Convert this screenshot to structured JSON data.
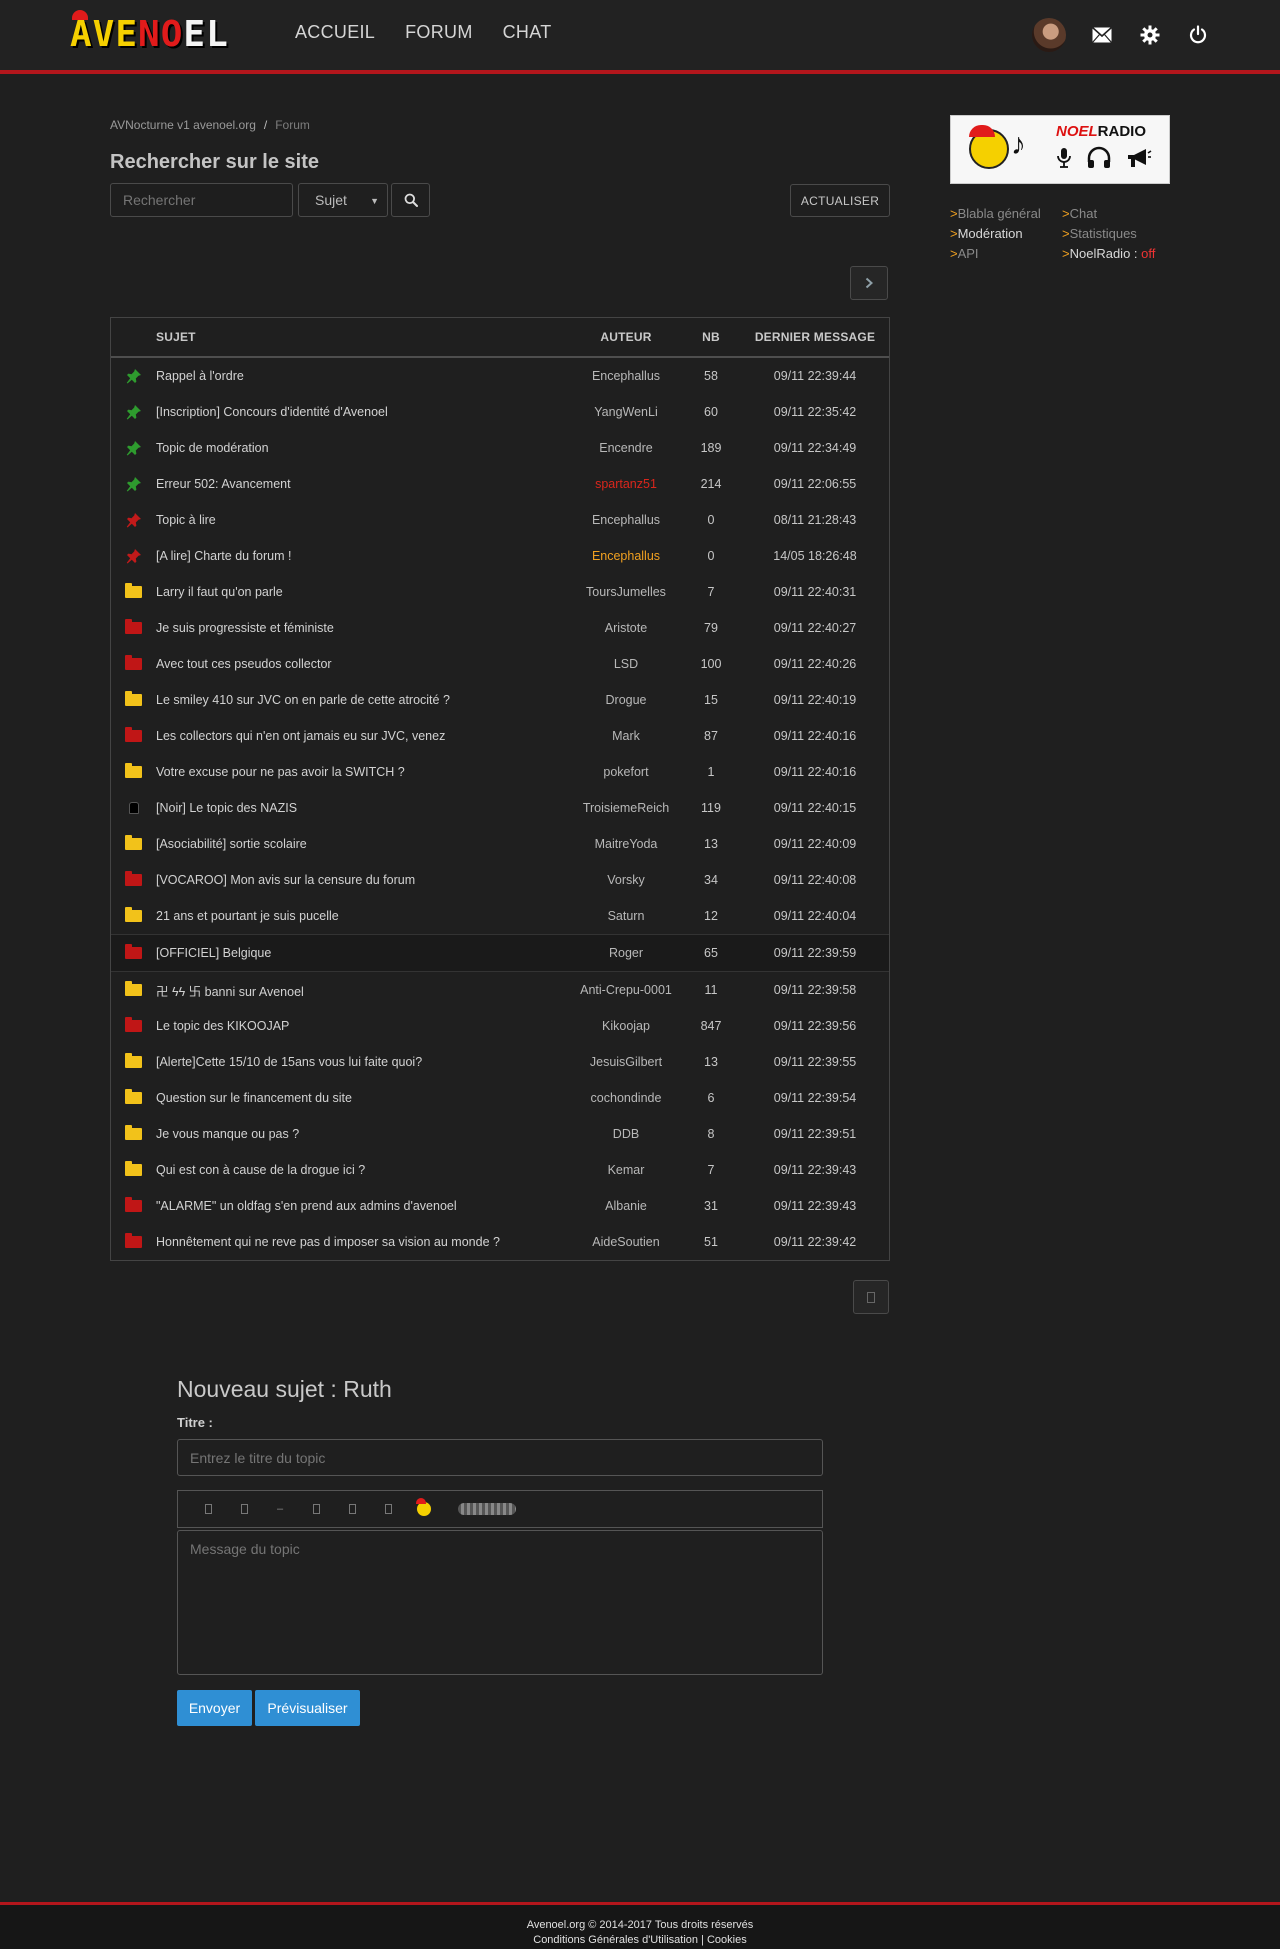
{
  "header": {
    "logo": {
      "part1": "AVE",
      "part2": "NO",
      "part3": "EL"
    },
    "nav": [
      "ACCUEIL",
      "FORUM",
      "CHAT"
    ],
    "icons": [
      "avatar",
      "mail-icon",
      "gear-icon",
      "power-icon"
    ]
  },
  "breadcrumb": {
    "home": "AVNocturne v1 avenoel.org",
    "separator": "/",
    "current": "Forum"
  },
  "search": {
    "title": "Rechercher sur le site",
    "placeholder": "Rechercher",
    "select_value": "Sujet",
    "refresh_label": "ACTUALISER"
  },
  "radio": {
    "name_part1": "NOEL",
    "name_part2": "RADIO"
  },
  "side_links": [
    {
      "label": "Blabla général"
    },
    {
      "label": "Chat"
    },
    {
      "label": "Modération"
    },
    {
      "label": "Statistiques"
    },
    {
      "label": "API"
    },
    {
      "label": "NoelRadio : ",
      "status": "off"
    }
  ],
  "table": {
    "headers": {
      "subject": "SUJET",
      "author": "AUTEUR",
      "count": "NB",
      "last": "DERNIER MESSAGE"
    },
    "rows": [
      {
        "icon": "pin-green",
        "subject": "Rappel à l'ordre",
        "author": "Encephallus",
        "nb": "58",
        "date": "09/11 22:39:44"
      },
      {
        "icon": "pin-green",
        "subject": "[Inscription] Concours d'identité d'Avenoel",
        "author": "YangWenLi",
        "nb": "60",
        "date": "09/11 22:35:42"
      },
      {
        "icon": "pin-green",
        "subject": "Topic de modération",
        "author": "Encendre",
        "nb": "189",
        "date": "09/11 22:34:49"
      },
      {
        "icon": "pin-green",
        "subject": "Erreur 502: Avancement",
        "author": "spartanz51",
        "author_color": "#d9261c",
        "nb": "214",
        "date": "09/11 22:06:55"
      },
      {
        "icon": "pin-red",
        "subject": "Topic à lire",
        "author": "Encephallus",
        "nb": "0",
        "date": "08/11 21:28:43"
      },
      {
        "icon": "pin-red",
        "subject": "[A lire] Charte du forum !",
        "author": "Encephallus",
        "author_color": "#f0a020",
        "nb": "0",
        "date": "14/05 18:26:48"
      },
      {
        "icon": "folder-yellow",
        "subject": "Larry il faut qu'on parle",
        "author": "ToursJumelles",
        "nb": "7",
        "date": "09/11 22:40:31"
      },
      {
        "icon": "folder-red",
        "subject": "Je suis progressiste et féministe",
        "author": "Aristote",
        "nb": "79",
        "date": "09/11 22:40:27"
      },
      {
        "icon": "folder-red",
        "subject": "Avec tout ces pseudos collector",
        "author": "LSD",
        "nb": "100",
        "date": "09/11 22:40:26"
      },
      {
        "icon": "folder-yellow",
        "subject": "Le smiley 410 sur JVC on en parle de cette atrocité ?",
        "author": "Drogue",
        "nb": "15",
        "date": "09/11 22:40:19"
      },
      {
        "icon": "folder-red",
        "subject": "Les collectors qui n'en ont jamais eu sur JVC, venez",
        "author": "Mark",
        "nb": "87",
        "date": "09/11 22:40:16"
      },
      {
        "icon": "folder-yellow",
        "subject": "Votre excuse pour ne pas avoir la SWITCH ?",
        "author": "pokefort",
        "nb": "1",
        "date": "09/11 22:40:16"
      },
      {
        "icon": "black",
        "subject": "[Noir] Le topic des NAZIS",
        "author": "TroisiemeReich",
        "nb": "119",
        "date": "09/11 22:40:15"
      },
      {
        "icon": "folder-yellow",
        "subject": "[Asociabilité] sortie scolaire",
        "author": "MaitreYoda",
        "nb": "13",
        "date": "09/11 22:40:09"
      },
      {
        "icon": "folder-red",
        "subject": "[VOCAROO] Mon avis sur la censure du forum",
        "author": "Vorsky",
        "nb": "34",
        "date": "09/11 22:40:08"
      },
      {
        "icon": "folder-yellow",
        "subject": "21 ans et pourtant je suis pucelle",
        "author": "Saturn",
        "nb": "12",
        "date": "09/11 22:40:04"
      },
      {
        "icon": "folder-red",
        "subject": "[OFFICIEL] Belgique",
        "author": "Roger",
        "nb": "65",
        "date": "09/11 22:39:59",
        "highlight": true
      },
      {
        "icon": "folder-yellow",
        "subject": "卍 ϟϟ 卐 banni sur Avenoel",
        "author": "Anti-Crepu-0001",
        "nb": "11",
        "date": "09/11 22:39:58"
      },
      {
        "icon": "folder-red",
        "subject": "Le topic des KIKOOJAP",
        "author": "Kikoojap",
        "nb": "847",
        "date": "09/11 22:39:56"
      },
      {
        "icon": "folder-yellow",
        "subject": "[Alerte]Cette 15/10 de 15ans vous lui faite quoi?",
        "author": "JesuisGilbert",
        "nb": "13",
        "date": "09/11 22:39:55"
      },
      {
        "icon": "folder-yellow",
        "subject": "Question sur le financement du site",
        "author": "cochondinde",
        "nb": "6",
        "date": "09/11 22:39:54"
      },
      {
        "icon": "folder-yellow",
        "subject": "Je vous manque ou pas ?",
        "author": "DDB",
        "nb": "8",
        "date": "09/11 22:39:51"
      },
      {
        "icon": "folder-yellow",
        "subject": "Qui est con à cause de la drogue ici ?",
        "author": "Kemar",
        "nb": "7",
        "date": "09/11 22:39:43"
      },
      {
        "icon": "folder-red",
        "subject": "\"ALARME\" un oldfag s'en prend aux admins d'avenoel",
        "author": "Albanie",
        "nb": "31",
        "date": "09/11 22:39:43"
      },
      {
        "icon": "folder-red",
        "subject": "Honnêtement qui ne reve pas d imposer sa vision au monde ?",
        "author": "AideSoutien",
        "nb": "51",
        "date": "09/11 22:39:42"
      }
    ]
  },
  "new_topic": {
    "heading": "Nouveau sujet : Ruth",
    "title_label": "Titre :",
    "title_placeholder": "Entrez le titre du topic",
    "message_placeholder": "Message du topic",
    "send_label": "Envoyer",
    "preview_label": "Prévisualiser",
    "toolbar_icons": [
      "bold-icon",
      "italic-icon",
      "strike-icon",
      "underline-icon",
      "spoiler-icon",
      "image-icon",
      "smiley-icon",
      "sticker-icon"
    ],
    "toolbar_glyphs": [
      "",
      "",
      "–",
      "",
      "",
      ""
    ]
  },
  "footer": {
    "line1": "Avenoel.org © 2014-2017 Tous droits réservés",
    "line2a": "Conditions Générales d'Utilisation",
    "line2sep": " | ",
    "line2b": "Cookies"
  },
  "colors": {
    "accent_red": "#b3161c",
    "link_orange": "#f0a020",
    "button_blue": "#2f8fd4",
    "pin_green": "#2e9b2e",
    "pin_red": "#c21a1a"
  }
}
